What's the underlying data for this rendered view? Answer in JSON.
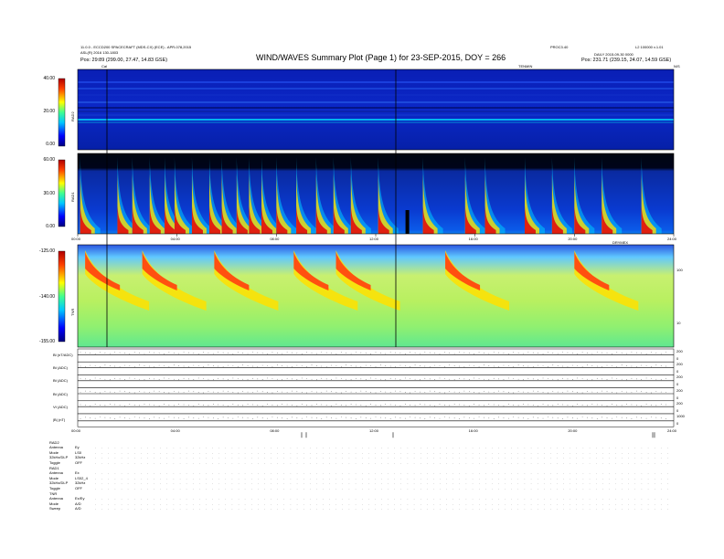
{
  "header": {
    "left_line1": "11.0.0 - ECCD200 SPACECRAFT (MDS-CX) (ECE) - APR-078,2015",
    "left_line2": "ASL(R) 2016 130-1803",
    "left_line3": "Pos:    29:89 (299.00, 27.47, 14.83 GSE)",
    "title": "WIND/WAVES Summary Plot (Page 1) for 23-SEP-2015, DOY = 266",
    "right_top1": "PROC3.40",
    "right_top2": "L2 100000 v.1.01",
    "right_line2": "DAILY 2015-09-30 0000",
    "right_line3": "Pos:   231.71 (239.15, 24.07, 14.59 GSE)",
    "tenmin_label": "TENMIN",
    "n_label": "N/S"
  },
  "colorbars": {
    "rad2": {
      "top": "40.00",
      "mid": "20.00",
      "bot": "0.00",
      "name": "RAD2"
    },
    "rad1": {
      "top": "60.00",
      "mid": "30.00",
      "bot": "0.00",
      "name": "RAD1"
    },
    "tnr": {
      "top": "-125.00",
      "mid": "-140.00",
      "bot": "-155.00",
      "name": "TNR"
    }
  },
  "time_axis": {
    "ticks": [
      "00:00",
      "04:00",
      "08:00",
      "12:00",
      "16:00",
      "20:00",
      "24:00"
    ],
    "label": "DRYMEX"
  },
  "lower_axis": {
    "ticks": [
      "00:00",
      "04:00",
      "08:00",
      "12:00",
      "16:00",
      "20:00",
      "24:00"
    ]
  },
  "tnr_right_axis": [
    "100",
    "10"
  ],
  "cal_label": "Cal",
  "line_panels": [
    {
      "label": "Bl (nT/ADC)",
      "right_hi": "200",
      "right_lo": "0"
    },
    {
      "label": "Bt (ADC)",
      "right_hi": "200",
      "right_lo": "0"
    },
    {
      "label": "Bt (ADC)",
      "right_hi": "200",
      "right_lo": "0"
    },
    {
      "label": "Bt (ADC)",
      "right_hi": "200",
      "right_lo": "0"
    },
    {
      "label": "Vt (ADC)",
      "right_hi": "200",
      "right_lo": "0"
    },
    {
      "label": "|B| (nT)",
      "right_hi": "1000",
      "right_lo": "0"
    }
  ],
  "status_block": {
    "groups": [
      {
        "title": "RAD2",
        "rows": [
          [
            "Antenna",
            "Ey"
          ],
          [
            "Mode",
            "LS0"
          ],
          [
            "32kHz/DLP",
            "32kHz"
          ],
          [
            "Toggle",
            "OFF"
          ]
        ]
      },
      {
        "title": "RAD1",
        "rows": [
          [
            "Antenna",
            "Ex"
          ],
          [
            "Mode",
            "LS02_4"
          ],
          [
            "32kHz/DLP",
            "32kHz"
          ],
          [
            "Toggle",
            "OFF"
          ]
        ]
      },
      {
        "title": "TNR",
        "rows": [
          [
            "Antenna",
            "Ex/Ey"
          ],
          [
            "Mode",
            "A/D"
          ],
          [
            "Sweep",
            "A/D"
          ]
        ]
      }
    ]
  },
  "colors": {
    "background": "#ffffff",
    "spectrum_low": "#00109a",
    "spectrum_high": "#e01a10"
  }
}
